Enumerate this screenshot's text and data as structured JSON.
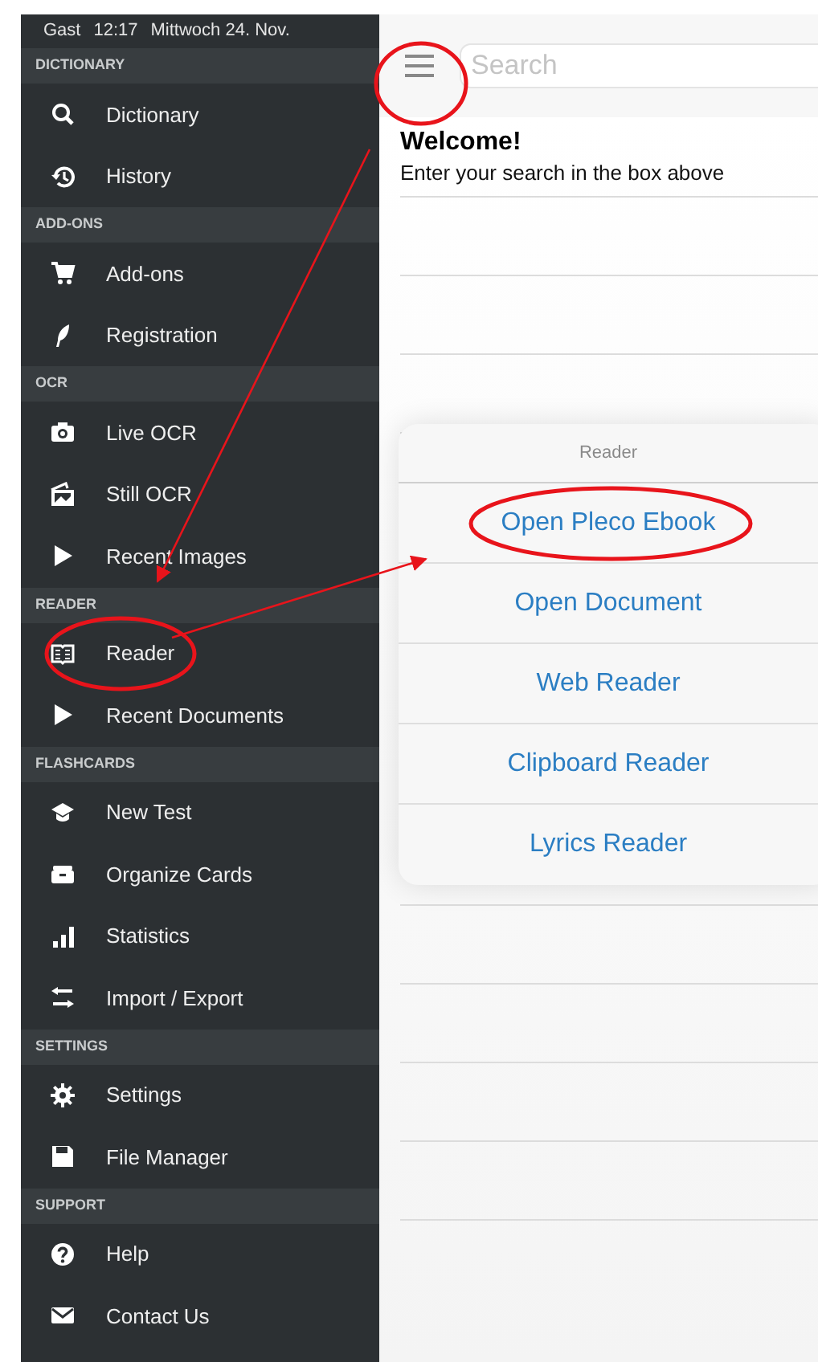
{
  "status_bar": {
    "user": "Gast",
    "time": "12:17",
    "date": "Mittwoch 24. Nov."
  },
  "sidebar": {
    "sections": [
      {
        "header": "DICTIONARY",
        "items": [
          {
            "label": "Dictionary"
          },
          {
            "label": "History"
          }
        ]
      },
      {
        "header": "ADD-ONS",
        "items": [
          {
            "label": "Add-ons"
          },
          {
            "label": "Registration"
          }
        ]
      },
      {
        "header": "OCR",
        "items": [
          {
            "label": "Live OCR"
          },
          {
            "label": "Still OCR"
          },
          {
            "label": "Recent Images"
          }
        ]
      },
      {
        "header": "READER",
        "items": [
          {
            "label": "Reader"
          },
          {
            "label": "Recent Documents"
          }
        ]
      },
      {
        "header": "FLASHCARDS",
        "items": [
          {
            "label": "New Test"
          },
          {
            "label": "Organize Cards"
          },
          {
            "label": "Statistics"
          },
          {
            "label": "Import / Export"
          }
        ]
      },
      {
        "header": "SETTINGS",
        "items": [
          {
            "label": "Settings"
          },
          {
            "label": "File Manager"
          }
        ]
      },
      {
        "header": "SUPPORT",
        "items": [
          {
            "label": "Help"
          },
          {
            "label": "Contact Us"
          }
        ]
      }
    ]
  },
  "search": {
    "placeholder": "Search"
  },
  "welcome": {
    "title": "Welcome!",
    "subtitle": "Enter your search in the box above"
  },
  "popover": {
    "title": "Reader",
    "items": [
      "Open Pleco Ebook",
      "Open Document",
      "Web Reader",
      "Clipboard Reader",
      "Lyrics Reader"
    ]
  }
}
